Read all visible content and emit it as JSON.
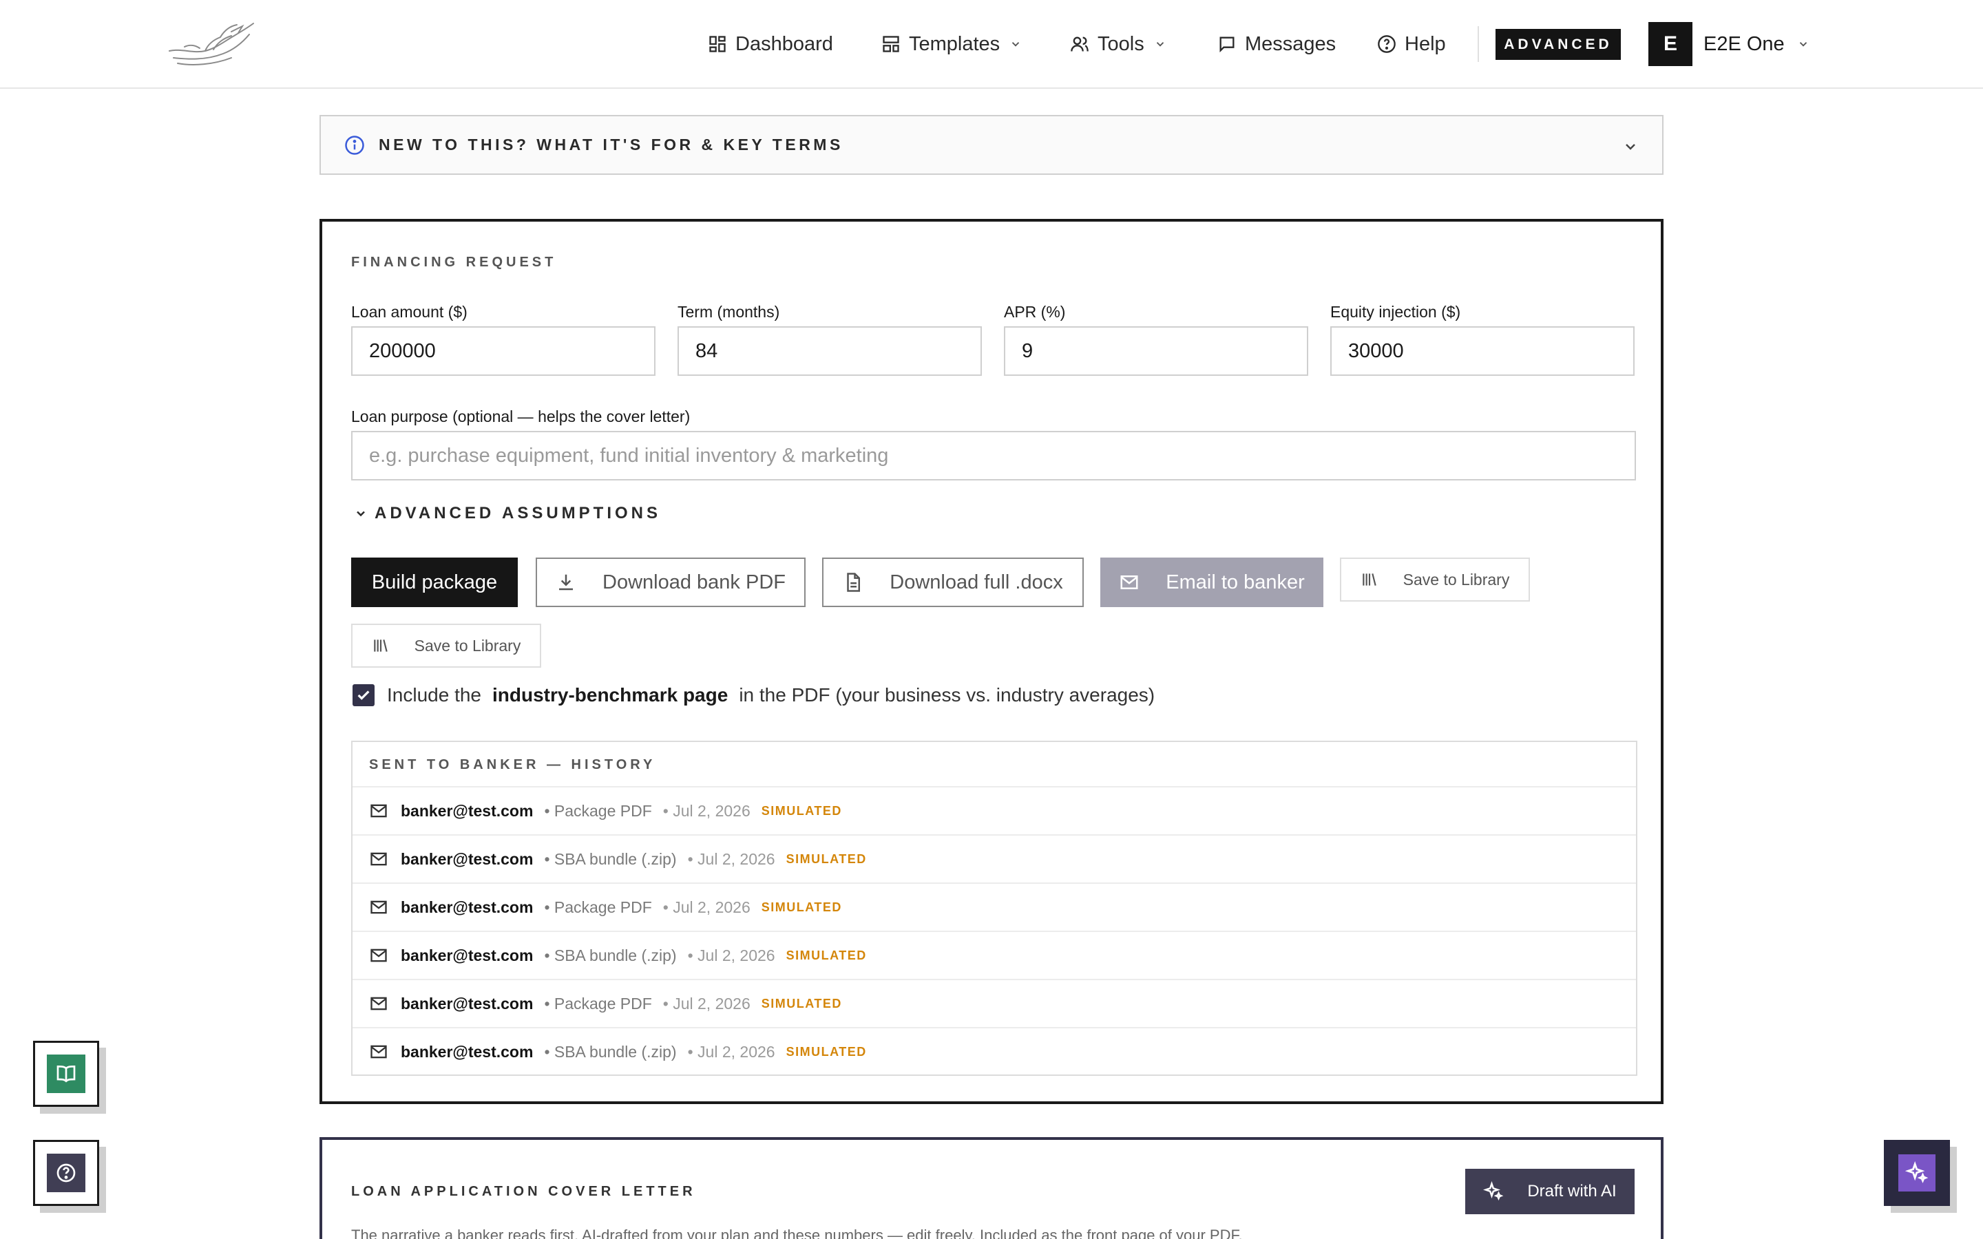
{
  "header": {
    "nav": {
      "dashboard": "Dashboard",
      "templates": "Templates",
      "tools": "Tools",
      "messages": "Messages",
      "help": "Help"
    },
    "mode_badge": "ADVANCED",
    "user": {
      "initial": "E",
      "name": "E2E One"
    }
  },
  "info_panel": {
    "label": "NEW TO THIS? WHAT IT'S FOR & KEY TERMS"
  },
  "financing": {
    "eyebrow": "FINANCING REQUEST",
    "fields": {
      "loan_amount": {
        "label": "Loan amount ($)",
        "value": "200000"
      },
      "term": {
        "label": "Term (months)",
        "value": "84"
      },
      "apr": {
        "label": "APR (%)",
        "value": "9"
      },
      "equity": {
        "label": "Equity injection ($)",
        "value": "30000"
      }
    },
    "purpose": {
      "label": "Loan purpose (optional — helps the cover letter)",
      "placeholder": "e.g. purchase equipment, fund initial inventory & marketing",
      "value": ""
    },
    "advanced_toggle": "ADVANCED ASSUMPTIONS",
    "buttons": {
      "build": "Build package",
      "download_pdf": "Download bank PDF",
      "download_docx": "Download full .docx",
      "email": "Email to banker",
      "save_library": "Save to Library",
      "save_library_2": "Save to Library"
    },
    "benchmark": {
      "prefix": "Include the",
      "bold": "industry-benchmark page",
      "suffix": "in the PDF (your business vs. industry averages)",
      "checked": true
    },
    "history": {
      "eyebrow": "SENT TO BANKER — HISTORY",
      "rows": [
        {
          "email": "banker@test.com",
          "type": "• Package PDF",
          "date": "• Jul 2, 2026",
          "status": "SIMULATED"
        },
        {
          "email": "banker@test.com",
          "type": "• SBA bundle (.zip)",
          "date": "• Jul 2, 2026",
          "status": "SIMULATED"
        },
        {
          "email": "banker@test.com",
          "type": "• Package PDF",
          "date": "• Jul 2, 2026",
          "status": "SIMULATED"
        },
        {
          "email": "banker@test.com",
          "type": "• SBA bundle (.zip)",
          "date": "• Jul 2, 2026",
          "status": "SIMULATED"
        },
        {
          "email": "banker@test.com",
          "type": "• Package PDF",
          "date": "• Jul 2, 2026",
          "status": "SIMULATED"
        },
        {
          "email": "banker@test.com",
          "type": "• SBA bundle (.zip)",
          "date": "• Jul 2, 2026",
          "status": "SIMULATED"
        }
      ]
    }
  },
  "cover_letter": {
    "eyebrow": "LOAN APPLICATION COVER LETTER",
    "description": "The narrative a banker reads first. AI-drafted from your plan and these numbers — edit freely. Included as the front page of your PDF.",
    "draft_button": "Draft with AI"
  },
  "icons": {
    "logo": "bird-logo",
    "nav": [
      "grid-icon",
      "template-icon",
      "users-icon",
      "message-icon",
      "help-circle-icon"
    ],
    "floating": [
      "book-icon",
      "help-circle-icon",
      "sparkles-icon"
    ]
  },
  "colors": {
    "primary": "#161616",
    "accent_purple": "#7a55c6",
    "book_green": "#2e8b62",
    "simulated_orange": "#d4860a",
    "muted_button": "#a3a2b0",
    "info_blue": "#3a5bd9"
  }
}
